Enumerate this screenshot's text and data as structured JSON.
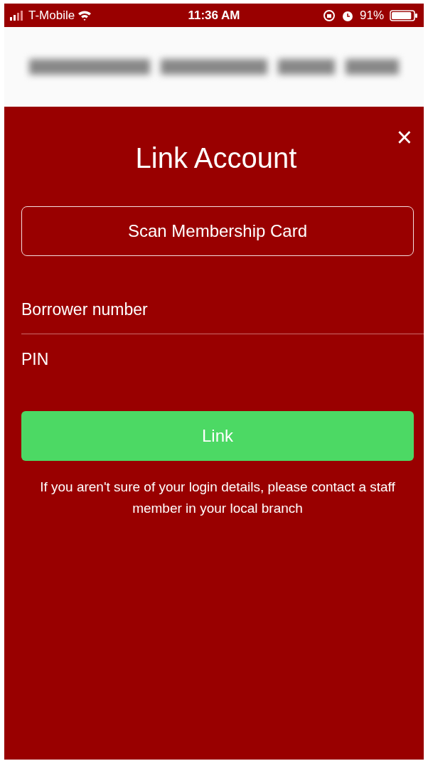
{
  "status_bar": {
    "carrier": "T-Mobile",
    "time": "11:36 AM",
    "battery_percent": "91%",
    "battery": {
      "level": 0.91
    }
  },
  "modal": {
    "title": "Link Account",
    "close": "×",
    "scan_button": "Scan Membership Card",
    "fields": [
      {
        "placeholder": "Borrower number"
      },
      {
        "placeholder": "PIN"
      }
    ],
    "link_button": "Link",
    "help_text": "If you aren't sure of your login details, please contact a staff member in your local branch"
  }
}
